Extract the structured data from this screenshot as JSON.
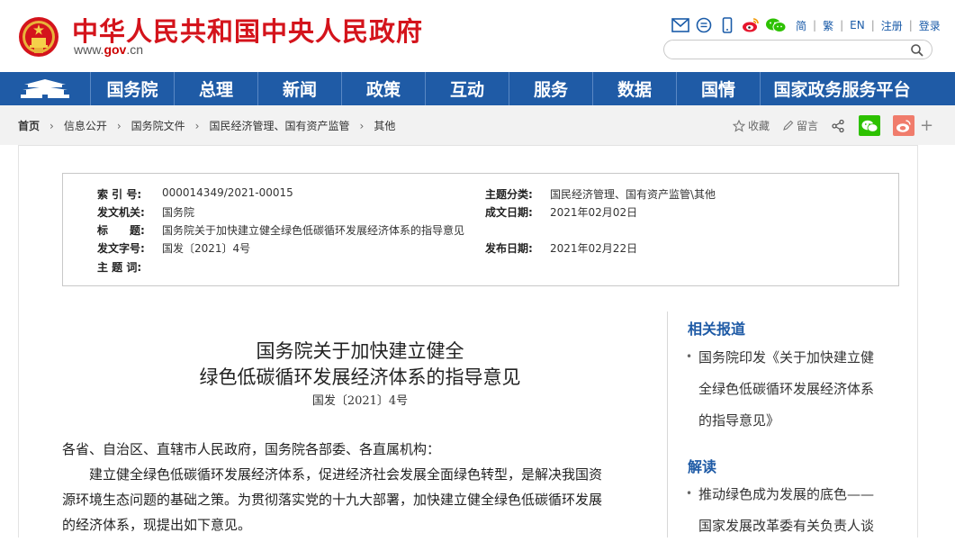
{
  "header": {
    "site_title": "中华人民共和国中央人民政府",
    "site_url_prefix": "www.",
    "site_url_gov": "gov",
    "site_url_suffix": ".cn",
    "top_icons": [
      "mail-icon",
      "chat-icon",
      "mobile-icon",
      "weibo-icon",
      "wechat-icon"
    ],
    "lang_links": [
      "简",
      "繁",
      "EN"
    ],
    "register": "注册",
    "login": "登录",
    "search_placeholder": ""
  },
  "nav": {
    "items": [
      "国务院",
      "总理",
      "新闻",
      "政策",
      "互动",
      "服务",
      "数据",
      "国情",
      "国家政务服务平台"
    ]
  },
  "breadcrumb": [
    "首页",
    "信息公开",
    "国务院文件",
    "国民经济管理、国有资产监管",
    "其他"
  ],
  "share": {
    "favorite": "收藏",
    "comment": "留言"
  },
  "meta": {
    "index_label": "索 引 号:",
    "index_value": "000014349/2021-00015",
    "category_label": "主题分类:",
    "category_value": "国民经济管理、国有资产监管\\其他",
    "issuer_label": "发文机关:",
    "issuer_value": "国务院",
    "written_label": "成文日期:",
    "written_value": "2021年02月02日",
    "title_label": "标　　题:",
    "title_value": "国务院关于加快建立健全绿色低碳循环发展经济体系的指导意见",
    "docno_label": "发文字号:",
    "docno_value": "国发〔2021〕4号",
    "published_label": "发布日期:",
    "published_value": "2021年02月22日",
    "keywords_label": "主 题 词:",
    "keywords_value": ""
  },
  "article": {
    "title_line1": "国务院关于加快建立健全",
    "title_line2": "绿色低碳循环发展经济体系的指导意见",
    "doc_number": "国发〔2021〕4号",
    "salutation": "各省、自治区、直辖市人民政府，国务院各部委、各直属机构：",
    "para1_line1": "　　建立健全绿色低碳循环发展经济体系，促进经济社会发展全面绿色转型，是解决我国资",
    "para1_line2": "源环境生态问题的基础之策。为贯彻落实党的十九大部署，加快建立健全绿色低碳循环发展",
    "para1_line3": "的经济体系，现提出如下意见。"
  },
  "sidebar": {
    "related_heading": "相关报道",
    "related_items": [
      {
        "line1": "国务院印发《关于加快建立健",
        "line2": "全绿色低碳循环发展经济体系",
        "line3": "的指导意见》"
      }
    ],
    "interpret_heading": "解读",
    "interpret_items": [
      {
        "line1": "推动绿色成为发展的底色——",
        "line2": "国家发展改革委有关负责人谈"
      }
    ]
  },
  "colors": {
    "brand_red": "#d4141c",
    "nav_blue": "#1f5ba6",
    "wechat_green": "#2dc100",
    "weibo_red": "#e6162d"
  }
}
